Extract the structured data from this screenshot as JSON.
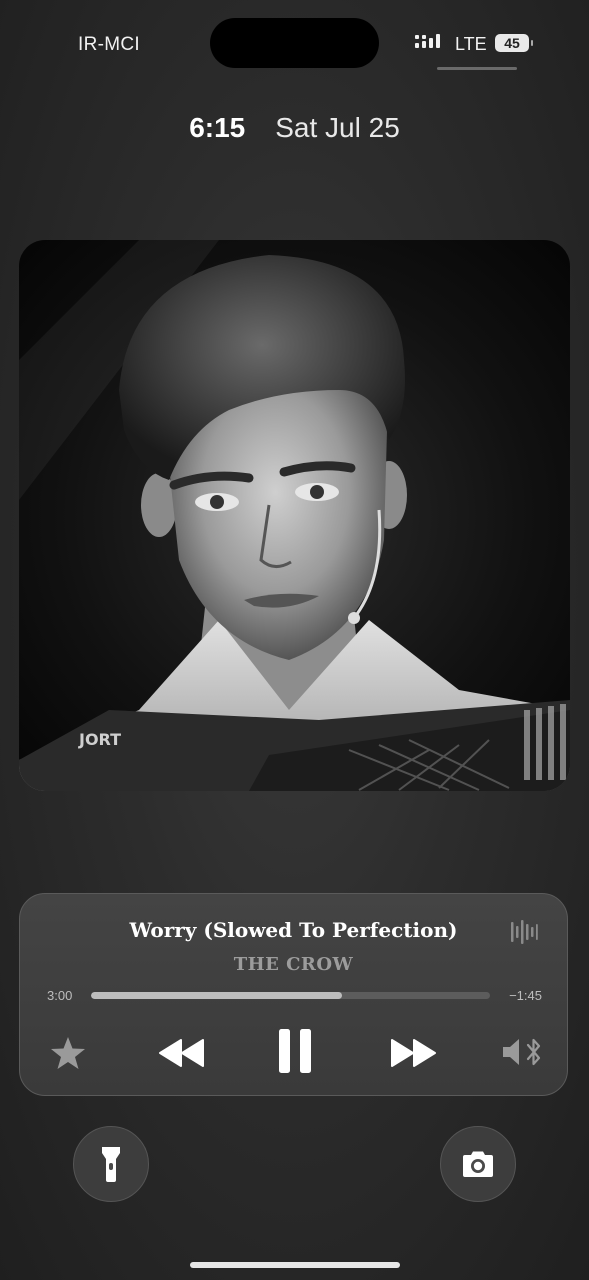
{
  "status_bar": {
    "carrier": "IR-MCI",
    "network": "LTE",
    "battery": "45"
  },
  "clock": {
    "time": "6:15",
    "date": "Sat Jul 25"
  },
  "artwork": {
    "jacket_text": "JORT"
  },
  "player": {
    "title": "Worry (Slowed To Perfection)",
    "artist": "THE CROW",
    "elapsed": "3:00",
    "remaining": "−1:45",
    "progress_fraction": 0.63
  },
  "icons": {
    "favorite": "star-icon",
    "previous": "rewind-icon",
    "play_pause": "pause-icon",
    "next": "forward-icon",
    "output": "speaker-bluetooth-icon",
    "waveform": "waveform-icon",
    "flashlight": "flashlight-icon",
    "camera": "camera-icon"
  },
  "colors": {
    "background": "#2c2c2c",
    "player_bg": "#3f3f3f",
    "progress_fill": "#bdbdbd",
    "artist_text": "#9c9c9c"
  }
}
